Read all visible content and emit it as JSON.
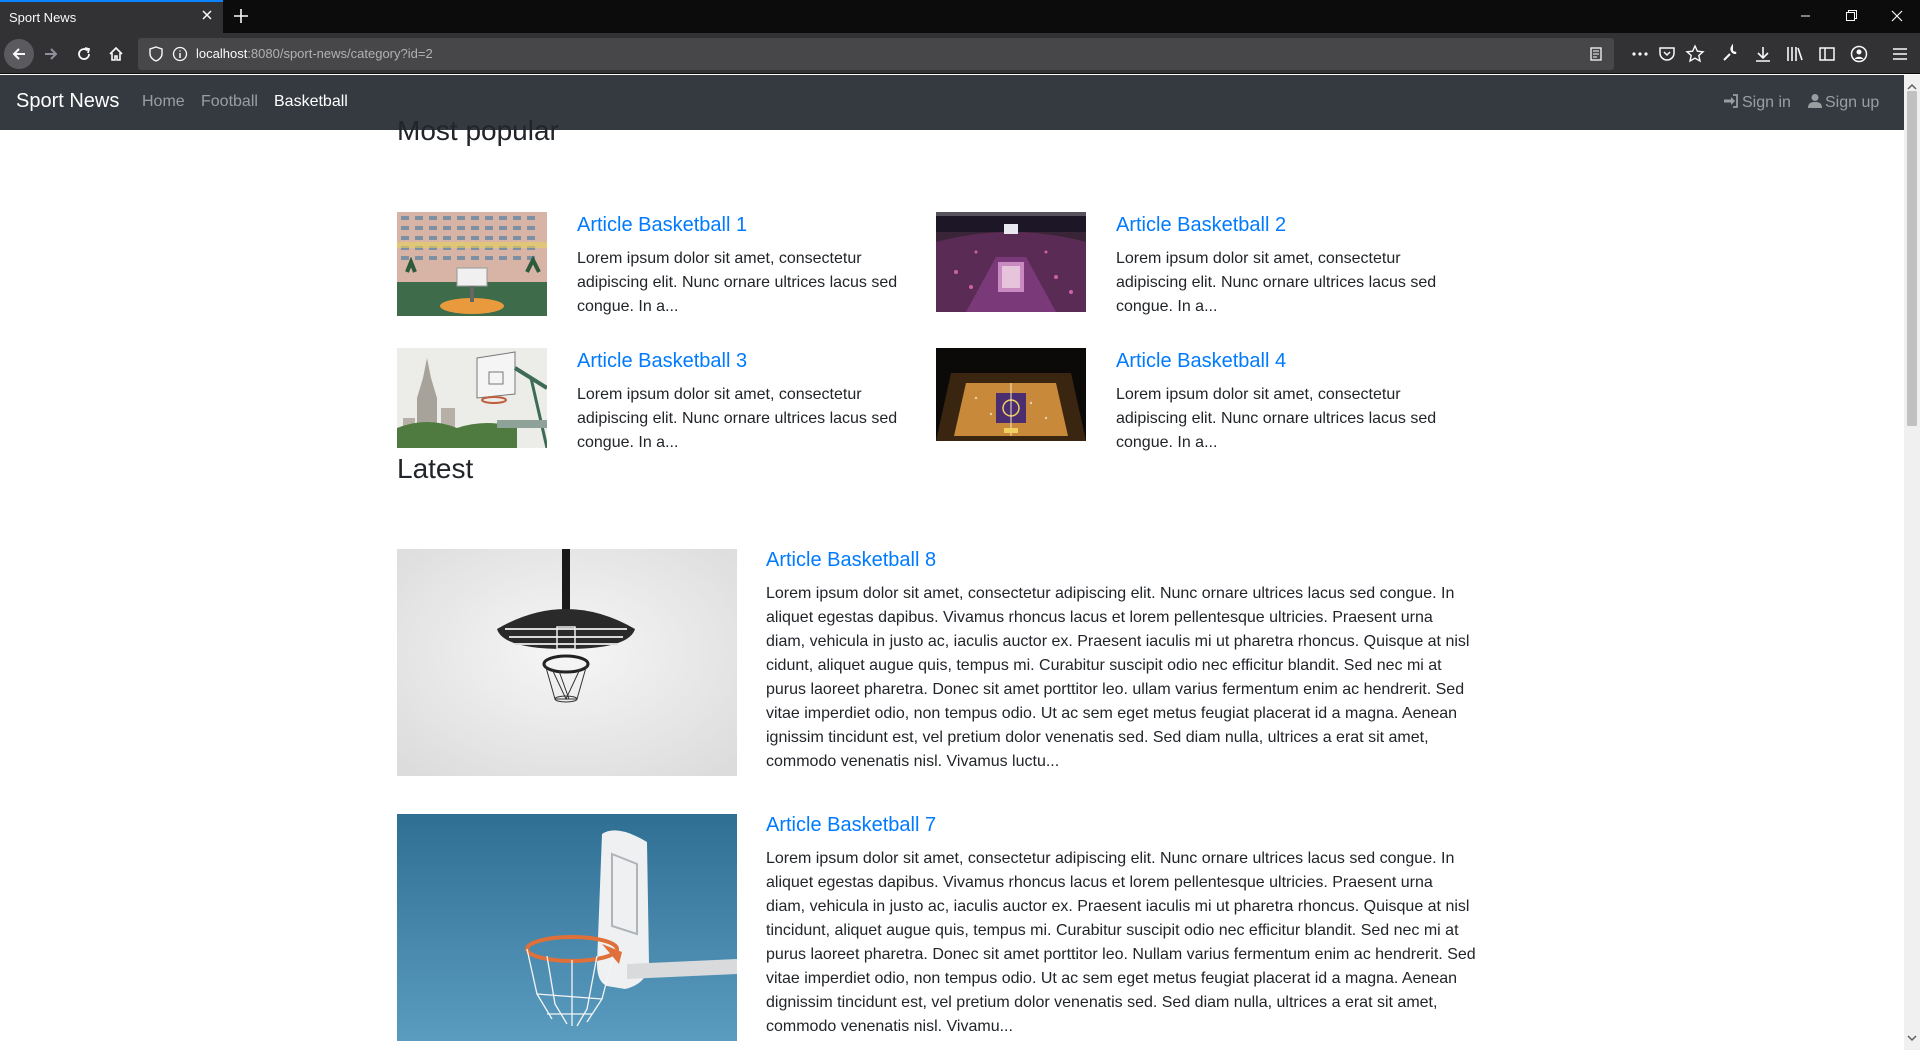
{
  "browser": {
    "tab_title": "Sport News",
    "url_host": "localhost",
    "url_rest": ":8080/sport-news/category?id=2"
  },
  "site": {
    "brand": "Sport News",
    "nav": [
      {
        "label": "Home",
        "active": false
      },
      {
        "label": "Football",
        "active": false
      },
      {
        "label": "Basketball",
        "active": true
      }
    ],
    "sign_in": "Sign in",
    "sign_up": "Sign up"
  },
  "most_popular": {
    "heading": "Most popular",
    "articles": [
      {
        "title": "Article Basketball 1",
        "excerpt": "Lorem ipsum dolor sit amet, consectetur adipiscing elit. Nunc ornare ultrices lacus sed congue. In a...",
        "image": "colorful-apartment-court"
      },
      {
        "title": "Article Basketball 2",
        "excerpt": "Lorem ipsum dolor sit amet, consectetur adipiscing elit. Nunc ornare ultrices lacus sed congue. In a...",
        "image": "arena-night"
      },
      {
        "title": "Article Basketball 3",
        "excerpt": "Lorem ipsum dolor sit amet, consectetur adipiscing elit. Nunc ornare ultrices lacus sed congue. In a...",
        "image": "hoop-city-skyline"
      },
      {
        "title": "Article Basketball 4",
        "excerpt": "Lorem ipsum dolor sit amet, consectetur adipiscing elit. Nunc ornare ultrices lacus sed congue. In a...",
        "image": "arena-court-aerial"
      }
    ]
  },
  "latest": {
    "heading": "Latest",
    "articles": [
      {
        "title": "Article Basketball 8",
        "excerpt": "Lorem ipsum dolor sit amet, consectetur adipiscing elit. Nunc ornare ultrices lacus sed congue. In aliquet egestas dapibus. Vivamus rhoncus lacus et lorem pellentesque ultricies. Praesent urna diam, vehicula in justo ac, iaculis auctor ex. Praesent iaculis mi ut pharetra rhoncus. Quisque at nisl cidunt, aliquet augue quis, tempus mi. Curabitur suscipit odio nec efficitur blandit. Sed nec mi at purus laoreet pharetra. Donec sit amet porttitor leo. ullam varius fermentum enim ac hendrerit. Sed vitae imperdiet odio, non tempus odio. Ut ac sem eget metus feugiat placerat id a magna. Aenean ignissim tincidunt est, vel pretium dolor venenatis sed. Sed diam nulla, ultrices a erat sit amet, commodo venenatis nisl. Vivamus luctu...",
        "image": "hoop-from-below-bw"
      },
      {
        "title": "Article Basketball 7",
        "excerpt": "Lorem ipsum dolor sit amet, consectetur adipiscing elit. Nunc ornare ultrices lacus sed congue. In aliquet egestas dapibus. Vivamus rhoncus lacus et lorem pellentesque ultricies. Praesent urna diam, vehicula in justo ac, iaculis auctor ex. Praesent iaculis mi ut pharetra rhoncus. Quisque at nisl tincidunt, aliquet augue quis, tempus mi. Curabitur suscipit odio nec efficitur blandit. Sed nec mi at purus laoreet pharetra. Donec sit amet porttitor leo. Nullam varius fermentum enim ac hendrerit. Sed vitae imperdiet odio, non tempus odio. Ut ac sem eget metus feugiat placerat id a magna. Aenean dignissim tincidunt est, vel pretium dolor venenatis sed. Sed diam nulla, ultrices a erat sit amet, commodo venenatis nisl. Vivamu...",
        "image": "hoop-blue-sky"
      }
    ]
  }
}
